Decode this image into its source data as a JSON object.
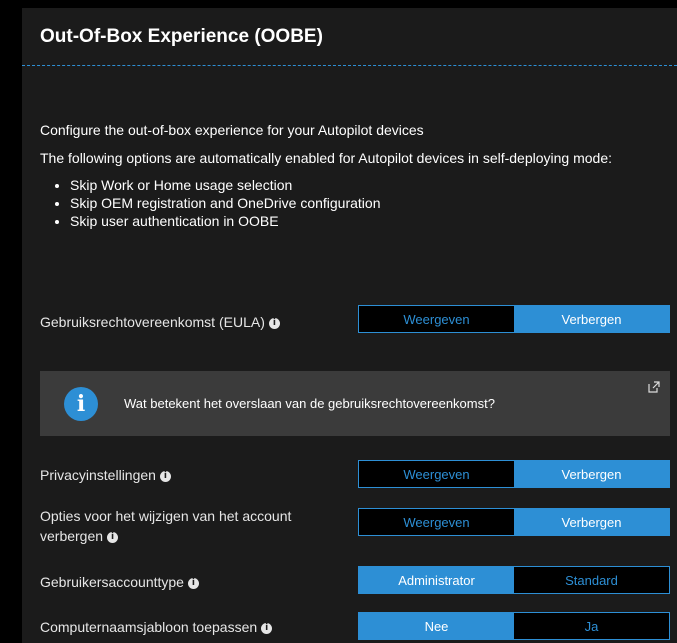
{
  "header": {
    "title": "Out-Of-Box Experience (OOBE)"
  },
  "intro": {
    "line1": "Configure the out-of-box experience for your Autopilot devices",
    "line2": "The following options are automatically enabled for Autopilot devices in self-deploying mode:",
    "bullets": [
      "Skip Work or Home usage selection",
      "Skip OEM registration and OneDrive configuration",
      "Skip user authentication in OOBE"
    ]
  },
  "settings": {
    "eula": {
      "label": "Gebruiksrechtovereenkomst (EULA)",
      "left": "Weergeven",
      "right": "Verbergen",
      "selected": "right"
    },
    "privacy": {
      "label": "Privacyinstellingen",
      "left": "Weergeven",
      "right": "Verbergen",
      "selected": "right"
    },
    "account_change": {
      "label": "Opties voor het wijzigen van het account verbergen",
      "left": "Weergeven",
      "right": "Verbergen",
      "selected": "right"
    },
    "account_type": {
      "label": "Gebruikersaccounttype",
      "left": "Administrator",
      "right": "Standard",
      "selected": "left"
    },
    "computer_name": {
      "label": "Computernaamsjabloon toepassen",
      "left": "Nee",
      "right": "Ja",
      "selected": "left"
    }
  },
  "info_banner": {
    "text": "Wat betekent het overslaan van de gebruiksrechtovereenkomst?",
    "icon": "info-icon",
    "link_icon": "external-link-icon"
  },
  "colors": {
    "accent": "#2d8fd5",
    "panel": "#1b1b1b",
    "banner": "#3b3b3b"
  }
}
